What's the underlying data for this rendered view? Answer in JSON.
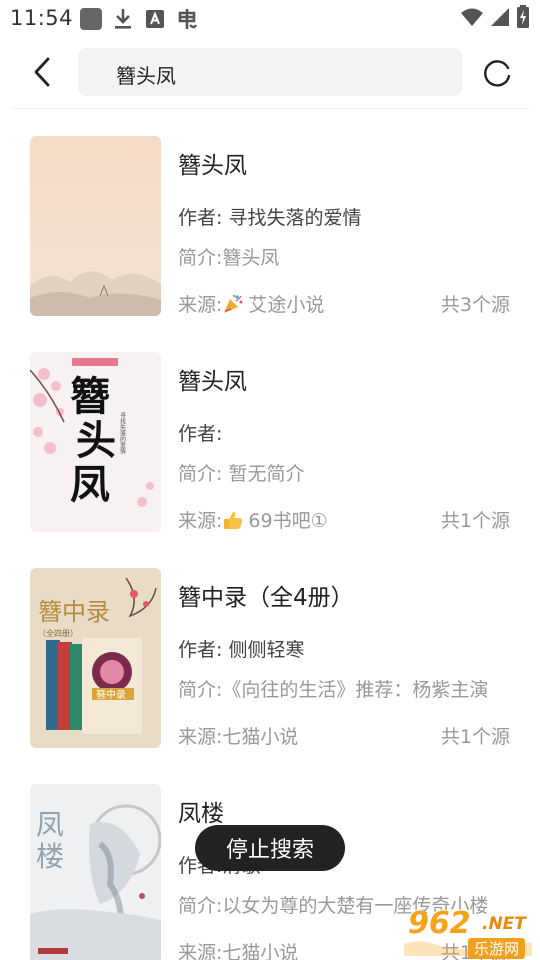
{
  "status_bar": {
    "time": "11:54",
    "left_icons": [
      "app-square-icon",
      "download-icon",
      "a-letter-icon",
      "bug-icon"
    ],
    "right_icons": [
      "wifi-icon",
      "signal-icon",
      "battery-charging-icon"
    ]
  },
  "search": {
    "query": "簪头凤",
    "back_icon": "chevron-left-icon",
    "refresh_icon": "refresh-loading-icon"
  },
  "results": [
    {
      "title": "簪头凤",
      "author": "作者: 寻找失落的爱情",
      "intro": "简介:簪头凤",
      "source_prefix": "来源:",
      "source_icon": "party-popper-icon",
      "source_name": " 艾途小说",
      "source_count": "共3个源"
    },
    {
      "title": "簪头凤",
      "author": "作者:",
      "intro": "简介: 暂无简介",
      "source_prefix": "来源:",
      "source_icon": "thumbs-up-icon",
      "source_name": " 69书吧①",
      "source_count": "共1个源",
      "cover_calligraphy": "簪头凤",
      "cover_small_text": "寻找失落的爱情"
    },
    {
      "title": "簪中录（全4册）",
      "author": "作者: 侧侧轻寒",
      "intro": "简介:《向往的生活》推荐：杨紫主演",
      "source_prefix": "来源:",
      "source_icon": "",
      "source_name": "七猫小说",
      "source_count": "共1个源",
      "cover_title": "簪中录",
      "cover_sub": "（全四册）",
      "cover_box_label": "簪中录"
    },
    {
      "title": "凤楼",
      "author": "作者:清歌",
      "intro": "简介:以女为尊的大楚有一座传奇小楼",
      "source_prefix": "来源:",
      "source_icon": "",
      "source_name": "七猫小说",
      "source_count": "共1个源",
      "cover_calligraphy": "凤楼"
    }
  ],
  "stop_button": {
    "label": "停止搜索"
  },
  "watermark": {
    "big": "962",
    "net": ".NET",
    "sub": "乐游网"
  },
  "colors": {
    "text_primary": "#222222",
    "text_secondary": "#999999",
    "pill_bg": "#222222",
    "search_bg": "#f3f3f3"
  }
}
